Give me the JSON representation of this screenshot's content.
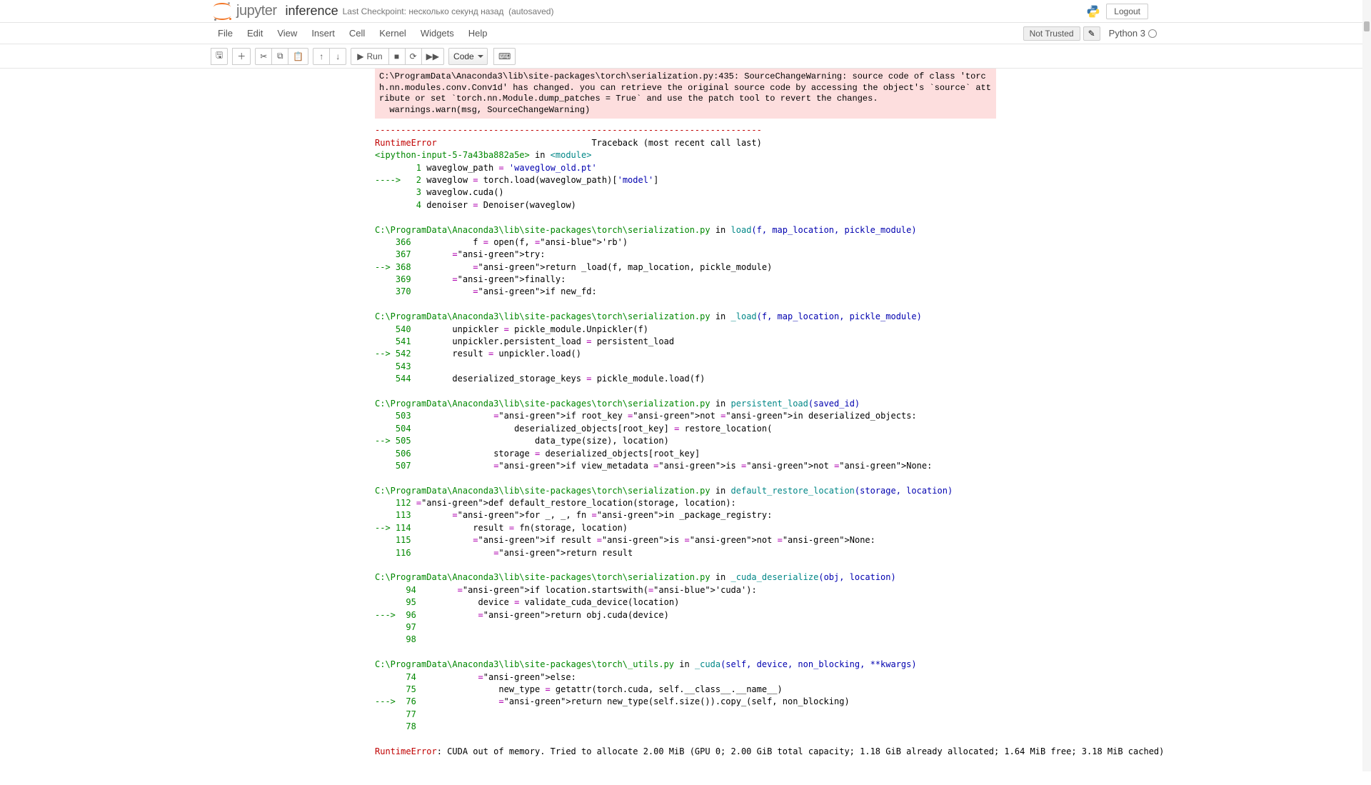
{
  "header": {
    "logo_text": "jupyter",
    "notebook_name": "inference",
    "checkpoint_label": "Last Checkpoint:",
    "checkpoint_time": "несколько секунд назад",
    "autosave": "(autosaved)",
    "logout": "Logout"
  },
  "menubar": {
    "items": [
      "File",
      "Edit",
      "View",
      "Insert",
      "Cell",
      "Kernel",
      "Widgets",
      "Help"
    ],
    "not_trusted": "Not Trusted",
    "kernel_name": "Python 3"
  },
  "toolbar": {
    "run_label": "Run",
    "cell_type": "Code"
  },
  "output": {
    "warning_text": "C:\\ProgramData\\Anaconda3\\lib\\site-packages\\torch\\serialization.py:435: SourceChangeWarning: source code of class 'torch.nn.modules.conv.Conv1d' has changed. you can retrieve the original source code by accessing the object's `source` attribute or set `torch.nn.Module.dump_patches = True` and use the patch tool to revert the changes.\n  warnings.warn(msg, SourceChangeWarning)",
    "tb_sep": "---------------------------------------------------------------------------",
    "tb_error_name": "RuntimeError",
    "tb_header_right": "Traceback (most recent call last)",
    "frames": [
      {
        "file": "<ipython-input-5-7a43ba882a5e>",
        "in": " in ",
        "func": "<module>",
        "args": "",
        "lines": [
          {
            "arrow": "      ",
            "num": "1",
            "pre": " waveglow_path ",
            "eq": "=",
            "post": " ",
            "str": "'waveglow_old.pt'",
            "tail": ""
          },
          {
            "arrow": "----> ",
            "num": "2",
            "pre": " waveglow ",
            "eq": "=",
            "post": " torch",
            "call": ".load(waveglow_path)[",
            "str2": "'model'",
            "tail2": "]"
          },
          {
            "arrow": "      ",
            "num": "3",
            "pre": " waveglow",
            "call2": ".cuda()"
          },
          {
            "arrow": "      ",
            "num": "4",
            "pre": " denoiser ",
            "eq": "=",
            "post": " Denoiser",
            "call3": "(waveglow)"
          }
        ]
      },
      {
        "file": "C:\\ProgramData\\Anaconda3\\lib\\site-packages\\torch\\serialization.py",
        "in": " in ",
        "func": "load",
        "args": "(f, map_location, pickle_module)",
        "lines": [
          {
            "arrow": "    ",
            "num": "366",
            "text": "            f = open(f, 'rb')"
          },
          {
            "arrow": "    ",
            "num": "367",
            "text": "        try:"
          },
          {
            "arrow": "--> ",
            "num": "368",
            "text": "            return _load(f, map_location, pickle_module)"
          },
          {
            "arrow": "    ",
            "num": "369",
            "text": "        finally:"
          },
          {
            "arrow": "    ",
            "num": "370",
            "text": "            if new_fd:"
          }
        ]
      },
      {
        "file": "C:\\ProgramData\\Anaconda3\\lib\\site-packages\\torch\\serialization.py",
        "in": " in ",
        "func": "_load",
        "args": "(f, map_location, pickle_module)",
        "lines": [
          {
            "arrow": "    ",
            "num": "540",
            "text": "        unpickler = pickle_module.Unpickler(f)"
          },
          {
            "arrow": "    ",
            "num": "541",
            "text": "        unpickler.persistent_load = persistent_load"
          },
          {
            "arrow": "--> ",
            "num": "542",
            "text": "        result = unpickler.load()"
          },
          {
            "arrow": "    ",
            "num": "543",
            "text": ""
          },
          {
            "arrow": "    ",
            "num": "544",
            "text": "        deserialized_storage_keys = pickle_module.load(f)"
          }
        ]
      },
      {
        "file": "C:\\ProgramData\\Anaconda3\\lib\\site-packages\\torch\\serialization.py",
        "in": " in ",
        "func": "persistent_load",
        "args": "(saved_id)",
        "lines": [
          {
            "arrow": "    ",
            "num": "503",
            "text": "                if root_key not in deserialized_objects:"
          },
          {
            "arrow": "    ",
            "num": "504",
            "text": "                    deserialized_objects[root_key] = restore_location("
          },
          {
            "arrow": "--> ",
            "num": "505",
            "text": "                        data_type(size), location)"
          },
          {
            "arrow": "    ",
            "num": "506",
            "text": "                storage = deserialized_objects[root_key]"
          },
          {
            "arrow": "    ",
            "num": "507",
            "text": "                if view_metadata is not None:"
          }
        ]
      },
      {
        "file": "C:\\ProgramData\\Anaconda3\\lib\\site-packages\\torch\\serialization.py",
        "in": " in ",
        "func": "default_restore_location",
        "args": "(storage, location)",
        "lines": [
          {
            "arrow": "    ",
            "num": "112",
            "text": " def default_restore_location(storage, location):"
          },
          {
            "arrow": "    ",
            "num": "113",
            "text": "        for _, _, fn in _package_registry:"
          },
          {
            "arrow": "--> ",
            "num": "114",
            "text": "            result = fn(storage, location)"
          },
          {
            "arrow": "    ",
            "num": "115",
            "text": "            if result is not None:"
          },
          {
            "arrow": "    ",
            "num": "116",
            "text": "                return result"
          }
        ]
      },
      {
        "file": "C:\\ProgramData\\Anaconda3\\lib\\site-packages\\torch\\serialization.py",
        "in": " in ",
        "func": "_cuda_deserialize",
        "args": "(obj, location)",
        "lines": [
          {
            "arrow": "     ",
            "num": "94",
            "text": "        if location.startswith('cuda'):"
          },
          {
            "arrow": "     ",
            "num": "95",
            "text": "            device = validate_cuda_device(location)"
          },
          {
            "arrow": "---> ",
            "num": "96",
            "text": "            return obj.cuda(device)"
          },
          {
            "arrow": "     ",
            "num": "97",
            "text": ""
          },
          {
            "arrow": "     ",
            "num": "98",
            "text": ""
          }
        ]
      },
      {
        "file": "C:\\ProgramData\\Anaconda3\\lib\\site-packages\\torch\\_utils.py",
        "in": " in ",
        "func": "_cuda",
        "args": "(self, device, non_blocking, **kwargs)",
        "lines": [
          {
            "arrow": "     ",
            "num": "74",
            "text": "            else:"
          },
          {
            "arrow": "     ",
            "num": "75",
            "text": "                new_type = getattr(torch.cuda, self.__class__.__name__)"
          },
          {
            "arrow": "---> ",
            "num": "76",
            "text": "                return new_type(self.size()).copy_(self, non_blocking)"
          },
          {
            "arrow": "     ",
            "num": "77",
            "text": ""
          },
          {
            "arrow": "     ",
            "num": "78",
            "text": ""
          }
        ]
      }
    ],
    "final_error": "RuntimeError",
    "final_msg": ": CUDA out of memory. Tried to allocate 2.00 MiB (GPU 0; 2.00 GiB total capacity; 1.18 GiB already allocated; 1.64 MiB free; 3.18 MiB cached)"
  }
}
